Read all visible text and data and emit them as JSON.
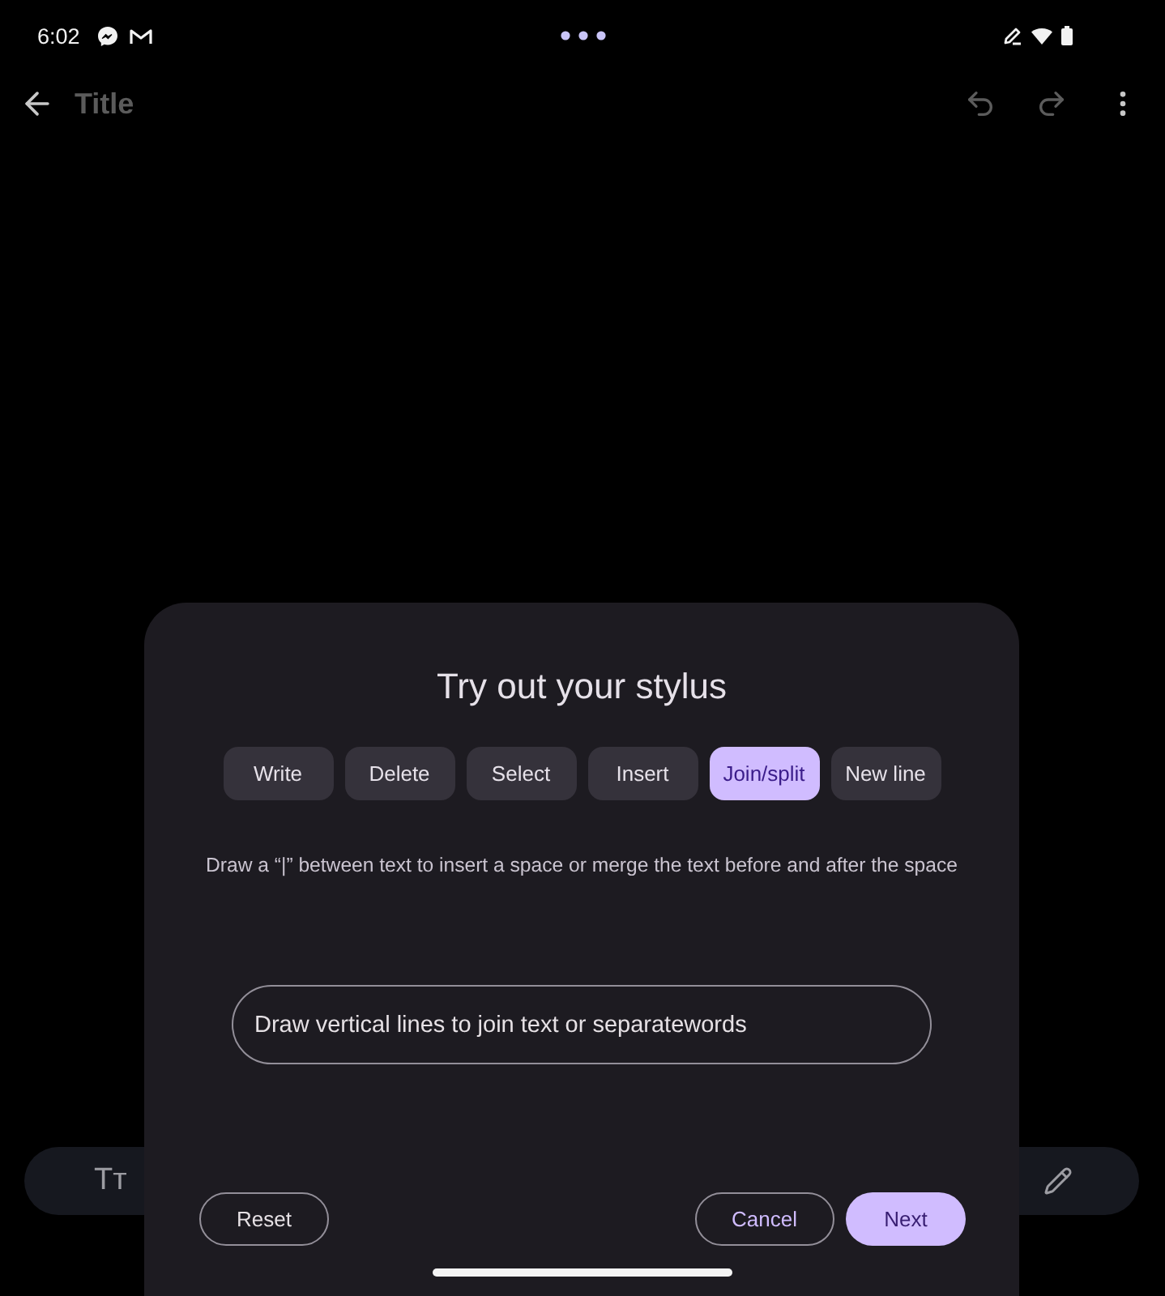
{
  "status_bar": {
    "time": "6:02"
  },
  "app_bar": {
    "title_field": {
      "placeholder": "Title"
    }
  },
  "toolbar": {
    "format_label": "Tт"
  },
  "dialog": {
    "title": "Try out your stylus",
    "tabs": [
      {
        "label": "Write",
        "selected": false
      },
      {
        "label": "Delete",
        "selected": false
      },
      {
        "label": "Select",
        "selected": false
      },
      {
        "label": "Insert",
        "selected": false
      },
      {
        "label": "Join/split",
        "selected": true
      },
      {
        "label": "New line",
        "selected": false
      }
    ],
    "description": "Draw a “|” between text to insert a space or merge the text before and after the space",
    "practice_field": {
      "value": "Draw vertical lines to join text or separatewords"
    },
    "start_buttons": [
      {
        "label": "Reset",
        "kind": "neutral"
      }
    ],
    "end_buttons": [
      {
        "label": "Cancel",
        "kind": "outlined"
      },
      {
        "label": "Next",
        "kind": "filled"
      }
    ]
  }
}
